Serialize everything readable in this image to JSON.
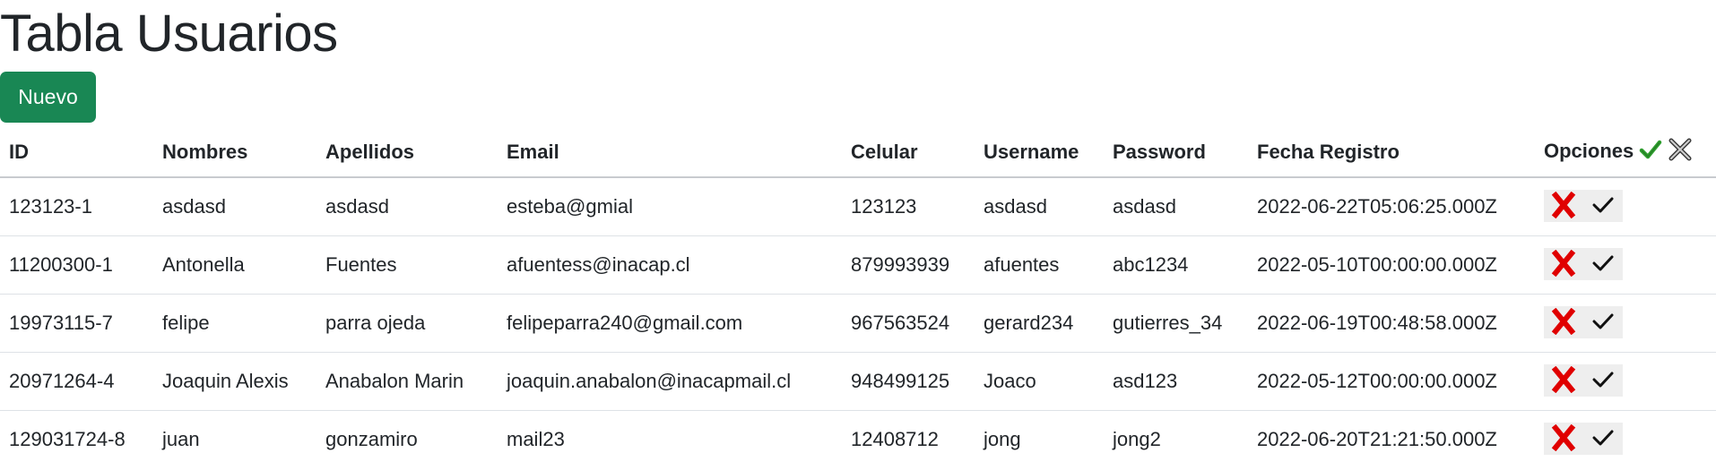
{
  "page": {
    "title": "Tabla Usuarios"
  },
  "toolbar": {
    "new_label": "Nuevo"
  },
  "table": {
    "columns": [
      "ID",
      "Nombres",
      "Apellidos",
      "Email",
      "Celular",
      "Username",
      "Password",
      "Fecha Registro",
      "Opciones"
    ],
    "header_icons": [
      "check-icon",
      "crossed-tools-icon"
    ],
    "row_actions": [
      "delete-x-icon",
      "check-icon"
    ],
    "rows": [
      [
        "123123-1",
        "asdasd",
        "asdasd",
        "esteba@gmial",
        "123123",
        "asdasd",
        "asdasd",
        "2022-06-22T05:06:25.000Z"
      ],
      [
        "11200300-1",
        "Antonella",
        "Fuentes",
        "afuentess@inacap.cl",
        "879993939",
        "afuentes",
        "abc1234",
        "2022-05-10T00:00:00.000Z"
      ],
      [
        "19973115-7",
        "felipe",
        "parra ojeda",
        "felipeparra240@gmail.com",
        "967563524",
        "gerard234",
        "gutierres_34",
        "2022-06-19T00:48:58.000Z"
      ],
      [
        "20971264-4",
        "Joaquin Alexis",
        "Anabalon Marin",
        "joaquin.anabalon@inacapmail.cl",
        "948499125",
        "Joaco",
        "asd123",
        "2022-05-12T00:00:00.000Z"
      ],
      [
        "129031724-8",
        "juan",
        "gonzamiro",
        "mail23",
        "12408712",
        "jong",
        "jong2",
        "2022-06-20T21:21:50.000Z"
      ]
    ]
  },
  "colors": {
    "primary_button": "#198754",
    "delete_icon": "#e00000",
    "check_icon_header": "#2e9e2e"
  }
}
